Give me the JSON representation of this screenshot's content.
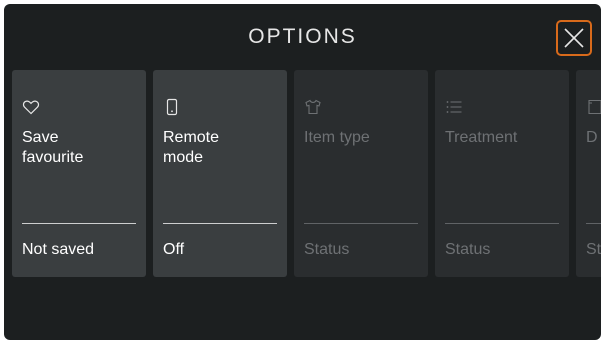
{
  "header": {
    "title": "OPTIONS"
  },
  "close": {
    "icon": "close-icon",
    "accent_color": "#d86a1b"
  },
  "options": [
    {
      "id": "save-favourite",
      "icon": "heart-icon",
      "label": "Save\nfavourite",
      "status": "Not saved",
      "enabled": true
    },
    {
      "id": "remote-mode",
      "icon": "phone-icon",
      "label": "Remote\nmode",
      "status": "Off",
      "enabled": true
    },
    {
      "id": "item-type",
      "icon": "shirt-icon",
      "label": "Item type",
      "status": "Status",
      "enabled": false
    },
    {
      "id": "treatment",
      "icon": "list-icon",
      "label": "Treatment",
      "status": "Status",
      "enabled": false
    },
    {
      "id": "partial",
      "icon": "garment-icon",
      "label": "D",
      "status": "St",
      "enabled": false
    }
  ]
}
